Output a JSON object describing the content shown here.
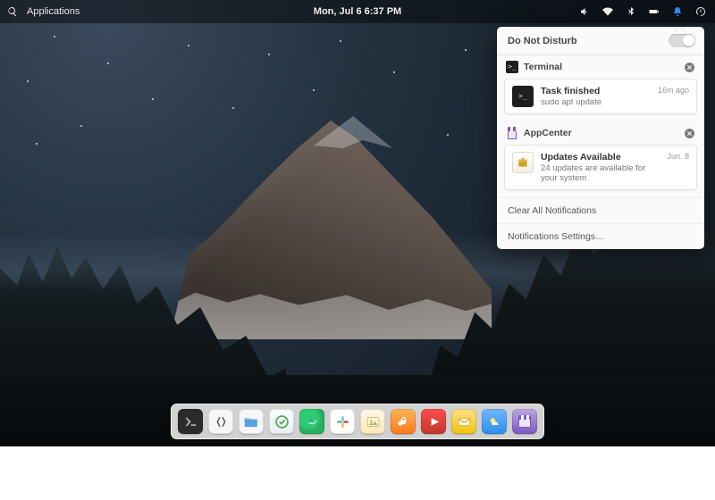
{
  "panel": {
    "applications_label": "Applications",
    "datetime": "Mon, Jul 6   6:37 PM"
  },
  "tray": [
    "volume",
    "network",
    "bluetooth",
    "battery",
    "notifications",
    "settings"
  ],
  "notifications": {
    "dnd_label": "Do Not Disturb",
    "dnd_on": false,
    "sections": [
      {
        "app": "Terminal",
        "icon": "terminal-icon",
        "items": [
          {
            "title": "Task finished",
            "body": "sudo apt update",
            "time": "16m ago"
          }
        ]
      },
      {
        "app": "AppCenter",
        "icon": "appcenter-icon",
        "items": [
          {
            "title": "Updates Available",
            "body": "24 updates are available for your system",
            "time": "Jun. 8"
          }
        ]
      }
    ],
    "clear_all": "Clear All Notifications",
    "settings": "Notifications Settings…"
  },
  "dock": [
    {
      "name": "terminal",
      "label": "Terminal"
    },
    {
      "name": "code",
      "label": "Code"
    },
    {
      "name": "files",
      "label": "Files"
    },
    {
      "name": "tasks",
      "label": "Tasks"
    },
    {
      "name": "web",
      "label": "Web"
    },
    {
      "name": "slack",
      "label": "Slack"
    },
    {
      "name": "photos",
      "label": "Photos"
    },
    {
      "name": "music",
      "label": "Music"
    },
    {
      "name": "videos",
      "label": "Videos"
    },
    {
      "name": "mail",
      "label": "Mail"
    },
    {
      "name": "weather",
      "label": "Weather"
    },
    {
      "name": "appcenter",
      "label": "AppCenter"
    }
  ]
}
